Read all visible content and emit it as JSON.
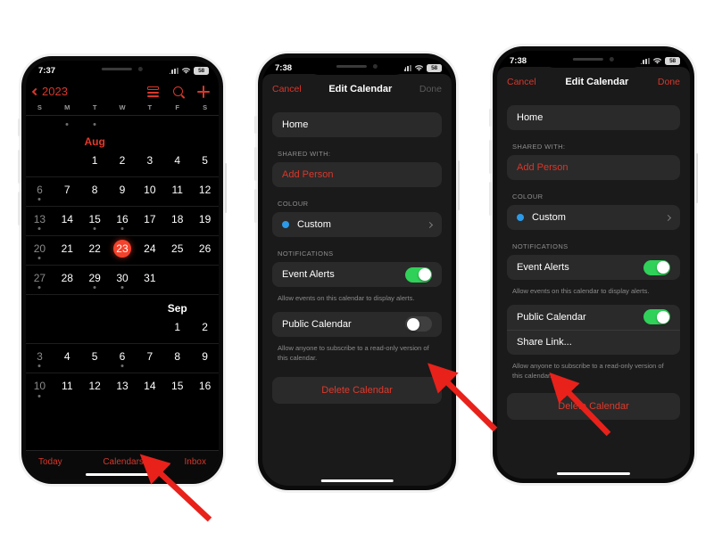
{
  "meta": {
    "background": "#ffffff",
    "accent_red": "#d9372b",
    "toggle_green": "#30d158",
    "today_red": "#f5422c",
    "colour_dot": "#2a9bea"
  },
  "phone1": {
    "status": {
      "time": "7:37",
      "battery": "58"
    },
    "header": {
      "back_label": "2023",
      "icons": [
        "list-icon",
        "search-icon",
        "plus-icon"
      ]
    },
    "weekdays": [
      "S",
      "M",
      "T",
      "W",
      "T",
      "F",
      "S"
    ],
    "months": [
      {
        "name": "Aug",
        "color": "red"
      },
      {
        "name": "Sep",
        "color": "white"
      }
    ],
    "calendar": {
      "partial_top_row": [
        {
          "d": "",
          "dot": false
        },
        {
          "d": "",
          "dot": true
        },
        {
          "d": "",
          "dot": true
        },
        {
          "d": "",
          "dot": false
        },
        {
          "d": "",
          "dot": false
        },
        {
          "d": "",
          "dot": false
        },
        {
          "d": "",
          "dot": false
        }
      ],
      "rows": [
        [
          {
            "d": "",
            "dim": true,
            "dot": false,
            "month": "Aug"
          },
          {
            "d": "",
            "dim": true,
            "dot": false
          },
          {
            "d": "1",
            "dim": false,
            "dot": false
          },
          {
            "d": "2",
            "dim": false,
            "dot": false
          },
          {
            "d": "3",
            "dim": false,
            "dot": false
          },
          {
            "d": "4",
            "dim": false,
            "dot": false
          },
          {
            "d": "5",
            "dim": false,
            "dot": false
          }
        ],
        [
          {
            "d": "6",
            "dim": true,
            "dot": true
          },
          {
            "d": "7",
            "dim": false,
            "dot": false
          },
          {
            "d": "8",
            "dim": false,
            "dot": false
          },
          {
            "d": "9",
            "dim": false,
            "dot": false
          },
          {
            "d": "10",
            "dim": false,
            "dot": false
          },
          {
            "d": "11",
            "dim": false,
            "dot": false
          },
          {
            "d": "12",
            "dim": false,
            "dot": false
          }
        ],
        [
          {
            "d": "13",
            "dim": true,
            "dot": true
          },
          {
            "d": "14",
            "dim": false,
            "dot": false
          },
          {
            "d": "15",
            "dim": false,
            "dot": true
          },
          {
            "d": "16",
            "dim": false,
            "dot": true
          },
          {
            "d": "17",
            "dim": false,
            "dot": false
          },
          {
            "d": "18",
            "dim": false,
            "dot": false
          },
          {
            "d": "19",
            "dim": false,
            "dot": false
          }
        ],
        [
          {
            "d": "20",
            "dim": true,
            "dot": true
          },
          {
            "d": "21",
            "dim": false,
            "dot": false
          },
          {
            "d": "22",
            "dim": false,
            "dot": false
          },
          {
            "d": "23",
            "dim": false,
            "dot": false,
            "today": true
          },
          {
            "d": "24",
            "dim": false,
            "dot": false
          },
          {
            "d": "25",
            "dim": false,
            "dot": false
          },
          {
            "d": "26",
            "dim": false,
            "dot": false
          }
        ],
        [
          {
            "d": "27",
            "dim": true,
            "dot": true
          },
          {
            "d": "28",
            "dim": false,
            "dot": false
          },
          {
            "d": "29",
            "dim": false,
            "dot": true
          },
          {
            "d": "30",
            "dim": false,
            "dot": true
          },
          {
            "d": "31",
            "dim": false,
            "dot": false
          },
          {
            "d": "",
            "dim": false,
            "dot": false
          },
          {
            "d": "",
            "dim": false,
            "dot": false
          }
        ],
        [
          {
            "d": "",
            "dim": false,
            "dot": false
          },
          {
            "d": "",
            "dim": false,
            "dot": false
          },
          {
            "d": "",
            "dim": false,
            "dot": false
          },
          {
            "d": "",
            "dim": false,
            "dot": false
          },
          {
            "d": "",
            "dim": false,
            "dot": false
          },
          {
            "d": "1",
            "dim": false,
            "dot": false
          },
          {
            "d": "2",
            "dim": false,
            "dot": false
          }
        ],
        [
          {
            "d": "3",
            "dim": true,
            "dot": true
          },
          {
            "d": "4",
            "dim": false,
            "dot": false
          },
          {
            "d": "5",
            "dim": false,
            "dot": false
          },
          {
            "d": "6",
            "dim": false,
            "dot": true
          },
          {
            "d": "7",
            "dim": false,
            "dot": false
          },
          {
            "d": "8",
            "dim": false,
            "dot": false
          },
          {
            "d": "9",
            "dim": false,
            "dot": false
          }
        ],
        [
          {
            "d": "10",
            "dim": true,
            "dot": true
          },
          {
            "d": "11",
            "dim": false,
            "dot": false
          },
          {
            "d": "12",
            "dim": false,
            "dot": false
          },
          {
            "d": "13",
            "dim": false,
            "dot": false
          },
          {
            "d": "14",
            "dim": false,
            "dot": false
          },
          {
            "d": "15",
            "dim": false,
            "dot": false
          },
          {
            "d": "16",
            "dim": false,
            "dot": false
          }
        ]
      ]
    },
    "tabbar": {
      "today": "Today",
      "calendars": "Calendars",
      "inbox": "Inbox"
    }
  },
  "phone2": {
    "status": {
      "time": "7:38",
      "battery": "58"
    },
    "nav": {
      "cancel": "Cancel",
      "title": "Edit Calendar",
      "done": "Done",
      "done_enabled": false
    },
    "name_field": {
      "value": "Home"
    },
    "shared_with": {
      "label": "SHARED WITH:",
      "add_person": "Add Person"
    },
    "colour": {
      "label": "COLOUR",
      "value": "Custom"
    },
    "notifications": {
      "label": "NOTIFICATIONS",
      "event_alerts": {
        "label": "Event Alerts",
        "on": true
      },
      "event_alerts_note": "Allow events on this calendar to display alerts.",
      "public_calendar": {
        "label": "Public Calendar",
        "on": false
      },
      "public_calendar_note": "Allow anyone to subscribe to a read-only version of this calendar."
    },
    "delete": "Delete Calendar"
  },
  "phone3": {
    "status": {
      "time": "7:38",
      "battery": "58"
    },
    "nav": {
      "cancel": "Cancel",
      "title": "Edit Calendar",
      "done": "Done",
      "done_enabled": true
    },
    "name_field": {
      "value": "Home"
    },
    "shared_with": {
      "label": "SHARED WITH:",
      "add_person": "Add Person"
    },
    "colour": {
      "label": "COLOUR",
      "value": "Custom"
    },
    "notifications": {
      "label": "NOTIFICATIONS",
      "event_alerts": {
        "label": "Event Alerts",
        "on": true
      },
      "event_alerts_note": "Allow events on this calendar to display alerts.",
      "public_calendar": {
        "label": "Public Calendar",
        "on": true
      },
      "share_link": "Share Link...",
      "public_calendar_note": "Allow anyone to subscribe to a read-only version of this calendar."
    },
    "delete": "Delete Calendar"
  },
  "annotations": {
    "arrow_color": "#e8211b",
    "arrows": [
      {
        "name": "arrow-to-calendars-tab",
        "points_to": "Calendars"
      },
      {
        "name": "arrow-to-public-calendar-toggle",
        "points_to": "Public Calendar toggle"
      },
      {
        "name": "arrow-to-share-link",
        "points_to": "Share Link..."
      }
    ]
  }
}
